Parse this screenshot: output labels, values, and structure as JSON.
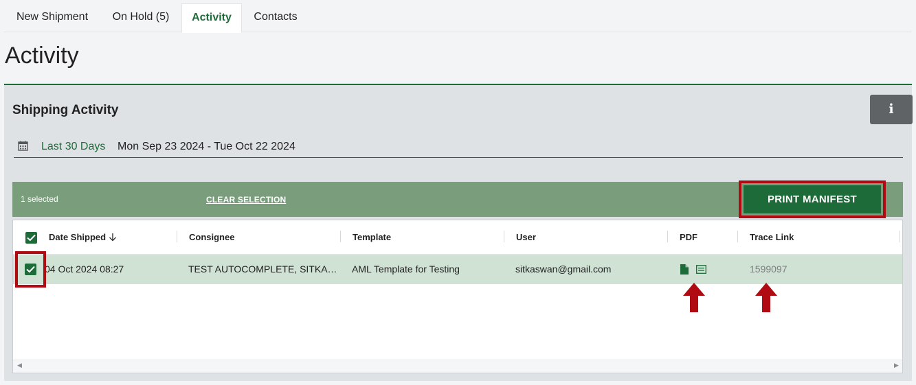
{
  "tabs": [
    {
      "label": "New Shipment"
    },
    {
      "label": "On Hold (5)"
    },
    {
      "label": "Activity",
      "active": true
    },
    {
      "label": "Contacts"
    }
  ],
  "page_title": "Activity",
  "panel": {
    "title": "Shipping Activity",
    "info_label": "i",
    "date_preset": "Last 30 Days",
    "date_range": "Mon Sep 23 2024 - Tue Oct 22 2024"
  },
  "selection": {
    "count_text": "1 selected",
    "clear_label": "CLEAR SELECTION",
    "print_label": "PRINT MANIFEST"
  },
  "grid": {
    "columns": [
      "Date Shipped",
      "Consignee",
      "Template",
      "User",
      "PDF",
      "Trace Link"
    ],
    "sort_column": "Date Shipped",
    "sort_direction": "descending",
    "rows": [
      {
        "selected": true,
        "date_shipped": "04 Oct 2024 08:27",
        "consignee": "TEST AUTOCOMPLETE, SITKA…",
        "template": "AML Template for Testing",
        "user": "sitkaswan@gmail.com",
        "pdf_icons": [
          "document-icon",
          "label-icon"
        ],
        "trace_link": "1599097"
      }
    ]
  },
  "colors": {
    "brand_green": "#1e6b3a",
    "selection_bar": "#7a9e7c",
    "selected_row": "#cfe2d3",
    "annotation_red": "#b00b12"
  }
}
